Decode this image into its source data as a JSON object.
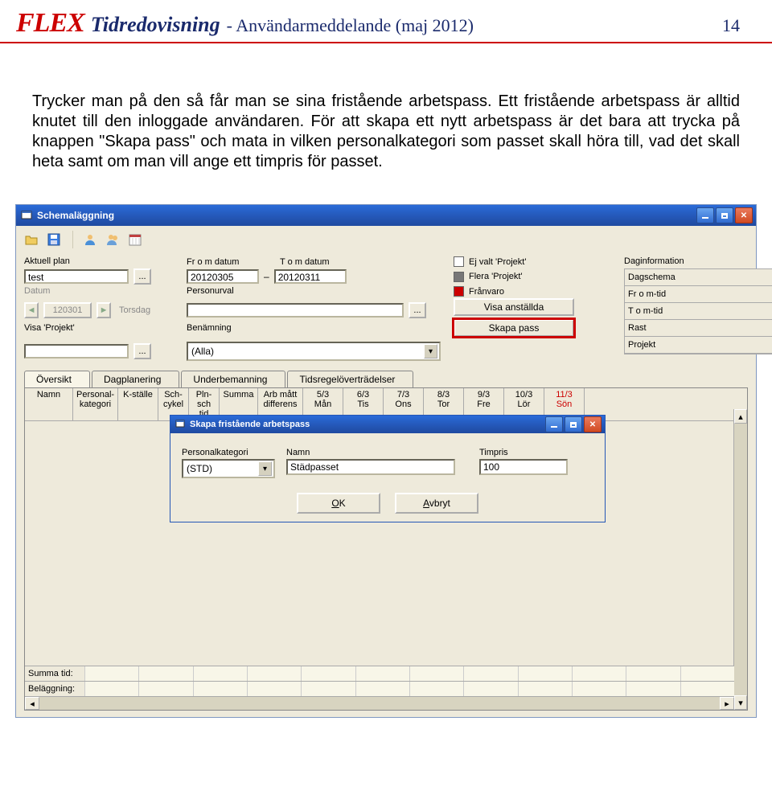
{
  "header": {
    "logo": "FLEX",
    "brand": "Tidredovisning",
    "subtitle": "- Användarmeddelande (maj 2012)",
    "page": "14"
  },
  "paragraph": "Trycker man på den så får man se sina fristående arbetspass. Ett fristående arbetspass är alltid knutet till den inloggade användaren. För att skapa ett nytt arbetspass är det bara att trycka på knappen \"Skapa pass\" och mata in vilken personalkategori som passet skall höra till, vad det skall heta samt om man vill ange ett timpris för passet.",
  "window": {
    "title": "Schemaläggning"
  },
  "labels": {
    "aktuell_plan": "Aktuell plan",
    "from_datum": "Fr o m datum",
    "tom_datum": "T o m datum",
    "datum": "Datum",
    "personurval": "Personurval",
    "visa_projekt": "Visa 'Projekt'",
    "benamning": "Benämning",
    "daginformation": "Daginformation"
  },
  "values": {
    "plan": "test",
    "from": "20120305",
    "tom": "20120311",
    "datum": "120301",
    "weekday": "Torsdag",
    "benamning_sel": "(Alla)"
  },
  "legend": {
    "a": "Ej valt 'Projekt'",
    "b": "Flera 'Projekt'",
    "c": "Frånvaro"
  },
  "actions": {
    "visa_anst": "Visa anställda",
    "skapa_pass": "Skapa pass"
  },
  "daginfo": [
    "Dagschema",
    "Fr o m-tid",
    "T o m-tid",
    "Rast",
    "Projekt"
  ],
  "tabs": [
    "Översikt",
    "Dagplanering",
    "Underbemanning",
    "Tidsregelöverträdelser"
  ],
  "grid_head": [
    {
      "l1": "Namn",
      "l2": "",
      "w": 60
    },
    {
      "l1": "Personal-",
      "l2": "kategori",
      "w": 56
    },
    {
      "l1": "K-ställe",
      "l2": "",
      "w": 50
    },
    {
      "l1": "Sch-",
      "l2": "cykel",
      "w": 38
    },
    {
      "l1": "Pln-",
      "l2": "sch tid",
      "w": 38
    },
    {
      "l1": "Summa",
      "l2": "",
      "w": 48
    },
    {
      "l1": "Arb mått",
      "l2": "differens",
      "w": 56
    },
    {
      "l1": "5/3",
      "l2": "Mån",
      "w": 50
    },
    {
      "l1": "6/3",
      "l2": "Tis",
      "w": 50
    },
    {
      "l1": "7/3",
      "l2": "Ons",
      "w": 50
    },
    {
      "l1": "8/3",
      "l2": "Tor",
      "w": 50
    },
    {
      "l1": "9/3",
      "l2": "Fre",
      "w": 50
    },
    {
      "l1": "10/3",
      "l2": "Lör",
      "w": 50
    },
    {
      "l1": "11/3",
      "l2": "Sön",
      "w": 50,
      "sun": true
    }
  ],
  "grid_foot": {
    "summa": "Summa tid:",
    "belagg": "Beläggning:"
  },
  "dialog": {
    "title": "Skapa fristående arbetspass",
    "personalkategori_lbl": "Personalkategori",
    "namn_lbl": "Namn",
    "timpris_lbl": "Timpris",
    "personalkategori_val": "(STD)",
    "namn_val": "Städpasset",
    "timpris_val": "100",
    "ok": "OK",
    "avbryt": "Avbryt"
  }
}
